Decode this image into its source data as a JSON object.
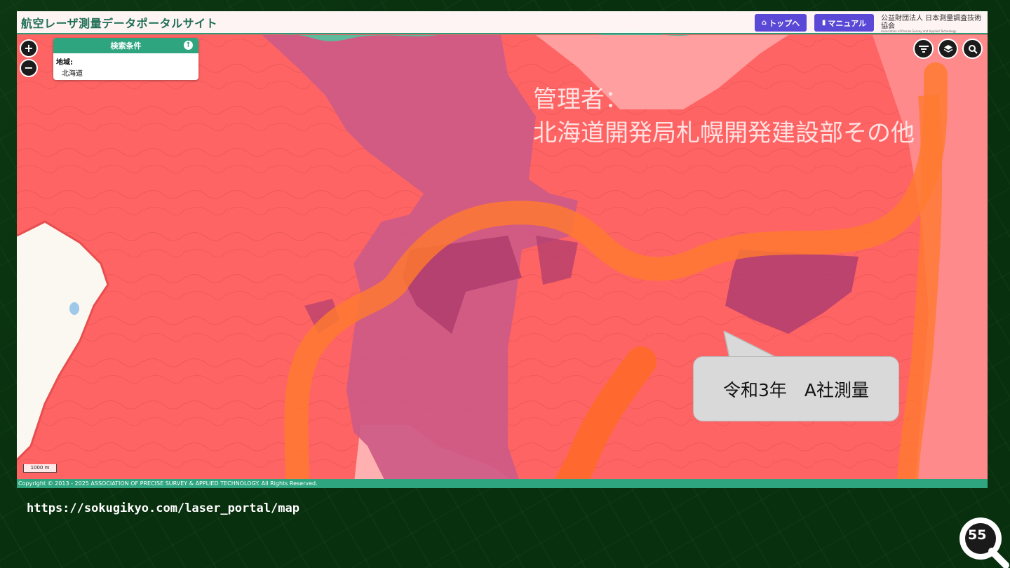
{
  "header": {
    "title": "航空レーザ測量データポータルサイト",
    "top_button": "トップへ",
    "manual_button": "マニュアル",
    "org_name": "公益財団法人 日本測量調査技術協会",
    "org_subtitle": "Association of Precise Survey and Applied Technology"
  },
  "map_controls": {
    "zoom_in": "+",
    "zoom_out": "−",
    "icons": [
      "filter-icon",
      "layers-icon",
      "search-icon"
    ]
  },
  "search_panel": {
    "title": "検索条件",
    "region_label": "地域:",
    "region_value": "北海道"
  },
  "annotation": {
    "line1": "管理者：",
    "line2": "北海道開発局札幌開発建設部その他"
  },
  "callout": {
    "text": "令和3年　A社測量"
  },
  "scale_bar": "1000 m",
  "footer": {
    "copyright": "Copyright © 2013 - 2025 ASSOCIATION OF PRECISE SURVEY & APPLIED TECHNOLOGY. All Rights Reserved."
  },
  "slide": {
    "url": "https://sokugikyo.com/laser_portal/map",
    "page_number": "55"
  },
  "colors": {
    "header_green": "#2fa57f",
    "button_purple": "#5a49d6",
    "coverage_red": "#ff6464",
    "overlap_purple": "#c04f7a",
    "route_orange": "#ff7a2e"
  }
}
